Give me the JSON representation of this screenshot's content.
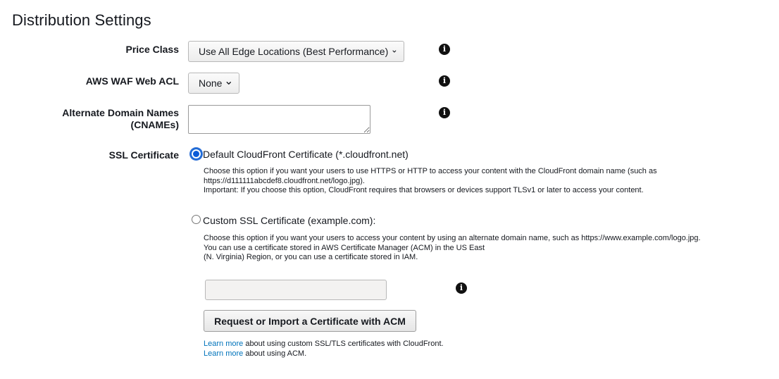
{
  "section": {
    "title": "Distribution Settings"
  },
  "price_class": {
    "label": "Price Class",
    "selected": "Use All Edge Locations (Best Performance)"
  },
  "waf": {
    "label": "AWS WAF Web ACL",
    "selected": "None"
  },
  "cnames": {
    "label_line1": "Alternate Domain Names",
    "label_line2": "(CNAMEs)",
    "value": ""
  },
  "ssl": {
    "label": "SSL Certificate",
    "default_option": {
      "label": "Default CloudFront Certificate (*.cloudfront.net)",
      "checked": true,
      "desc_line1": "Choose this option if you want your users to use HTTPS or HTTP to access your content with the CloudFront domain name (such as",
      "desc_line2": "https://d111111abcdef8.cloudfront.net/logo.jpg).",
      "desc_line3": "Important: If you choose this option, CloudFront requires that browsers or devices support TLSv1 or later to access your content."
    },
    "custom_option": {
      "label": "Custom SSL Certificate (example.com):",
      "checked": false,
      "desc_line1": "Choose this option if you want your users to access your content by using an alternate domain name, such as https://www.example.com/logo.jpg.",
      "desc_line2": "You can use a certificate stored in AWS Certificate Manager (ACM) in the US East",
      "desc_line3": "(N. Virginia) Region, or you can use a certificate stored in IAM."
    },
    "certificate_value": "",
    "acm_button": "Request or Import a Certificate with ACM",
    "learn_more_1_link": "Learn more",
    "learn_more_1_text": " about using custom SSL/TLS certificates with CloudFront.",
    "learn_more_2_link": "Learn more",
    "learn_more_2_text": " about using ACM."
  },
  "icons": {
    "info": "info-icon",
    "chevron": "chevron-down-icon"
  },
  "colors": {
    "link": "#0073bb",
    "radio_selected": "#0b5cd8",
    "text": "#16191f"
  }
}
